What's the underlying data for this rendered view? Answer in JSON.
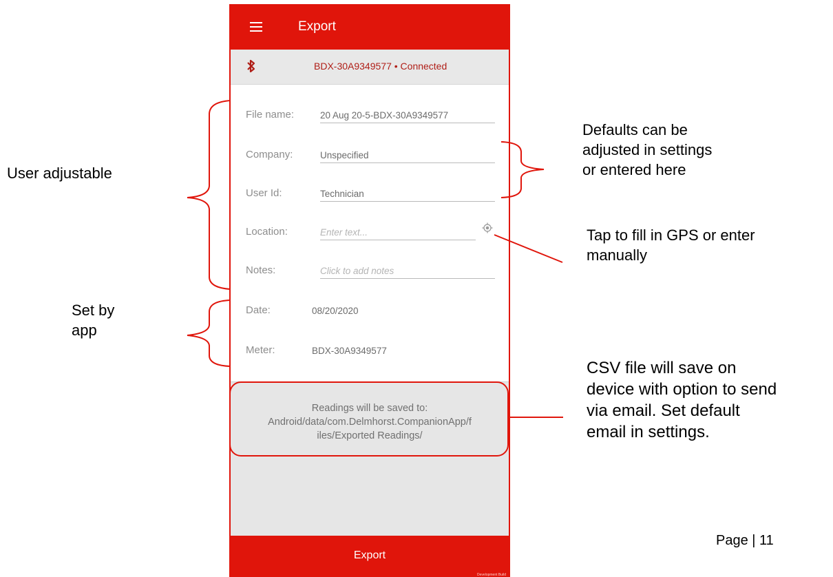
{
  "app": {
    "title": "Export",
    "device_status": "BDX-30A9349577 • Connected",
    "colors": {
      "primary": "#e0150b",
      "annotation": "#e0150b"
    }
  },
  "form": {
    "file_name": {
      "label": "File name:",
      "value": "20 Aug 20-5-BDX-30A9349577"
    },
    "company": {
      "label": "Company:",
      "value": "Unspecified"
    },
    "user_id": {
      "label": "User Id:",
      "value": "Technician"
    },
    "location": {
      "label": "Location:",
      "placeholder": "Enter text..."
    },
    "notes": {
      "label": "Notes:",
      "placeholder": "Click to add notes"
    },
    "date": {
      "label": "Date:",
      "value": "08/20/2020"
    },
    "meter": {
      "label": "Meter:",
      "value": "BDX-30A9349577"
    }
  },
  "save_info": {
    "line1": "Readings will be saved to:",
    "line2": "Android/data/com.Delmhorst.CompanionApp/f",
    "line3": "iles/Exported Readings/"
  },
  "export_button": {
    "label": "Export"
  },
  "annotations": {
    "user_adjustable": "User adjustable",
    "set_by_app_1": "Set by",
    "set_by_app_2": "app",
    "defaults_1": "Defaults can be",
    "defaults_2": "adjusted in settings",
    "defaults_3": "or entered here",
    "gps_1": "Tap to fill in GPS or enter",
    "gps_2": "manually",
    "csv_1": "CSV file will save on",
    "csv_2": "device with option to  send",
    "csv_3": "via email. Set default",
    "csv_4": "email in settings."
  },
  "page_label": "Page | 11",
  "icons": [
    "menu-icon",
    "bluetooth-icon",
    "gps-target-icon"
  ]
}
